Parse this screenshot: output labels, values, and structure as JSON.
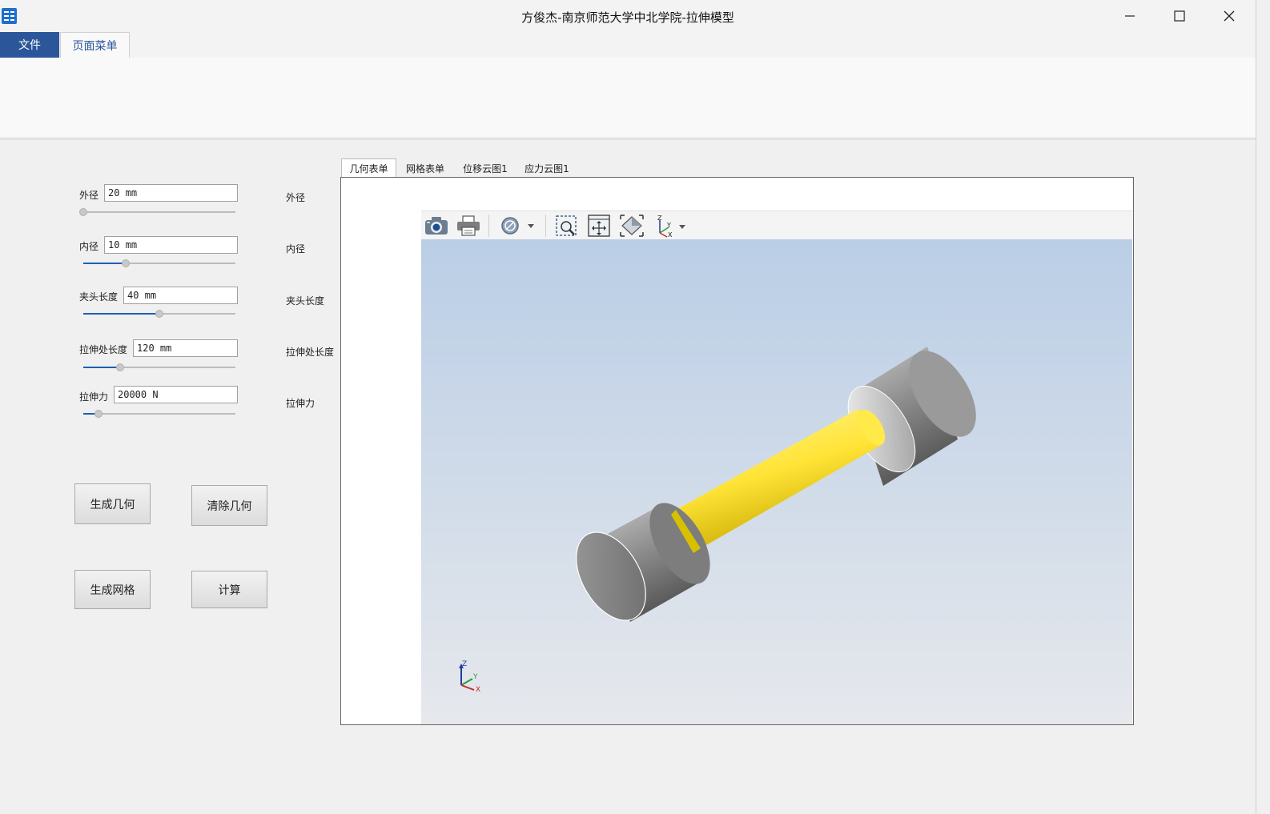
{
  "window": {
    "title": "方俊杰-南京师范大学中北学院-拉伸模型",
    "icons": [
      "app-icon",
      "minimize-icon",
      "maximize-icon",
      "close-icon"
    ]
  },
  "ribbon": {
    "tabs": [
      {
        "label": "文件",
        "selected": false
      },
      {
        "label": "页面菜单",
        "selected": true
      }
    ]
  },
  "params": [
    {
      "label": "外径",
      "value": "20 mm",
      "slider_fraction": 0.0
    },
    {
      "label": "内径",
      "value": "10 mm",
      "slider_fraction": 0.28
    },
    {
      "label": "夹头长度",
      "value": "40 mm",
      "slider_fraction": 0.5
    },
    {
      "label": "拉伸处长度",
      "value": "120 mm",
      "slider_fraction": 0.24
    },
    {
      "label": "拉伸力",
      "value": "20000 N",
      "slider_fraction": 0.1
    }
  ],
  "right_labels": [
    "外径",
    "内径",
    "夹头长度",
    "拉伸处长度",
    "拉伸力"
  ],
  "buttons": {
    "generate_geometry": "生成几何",
    "clear_geometry": "清除几何",
    "generate_mesh": "生成网格",
    "compute": "计算"
  },
  "view_tabs": [
    {
      "label": "几何表单",
      "selected": true
    },
    {
      "label": "网格表单",
      "selected": false
    },
    {
      "label": "位移云图1",
      "selected": false
    },
    {
      "label": "应力云图1",
      "selected": false
    }
  ],
  "viewer_toolbar": {
    "icons": [
      "camera-icon",
      "print-icon",
      "display-mode-icon",
      "zoom-window-icon",
      "pan-icon",
      "fit-view-icon",
      "view-orientation-icon"
    ]
  },
  "axis_triad": {
    "z": "Z",
    "y": "Y",
    "x": "X"
  },
  "colors": {
    "accent": "#2b579a",
    "gauge_section": "#ffea4a",
    "grip": "#8a8a8a",
    "viewport_top": "#bacee6",
    "viewport_bottom": "#e6e8ec"
  }
}
